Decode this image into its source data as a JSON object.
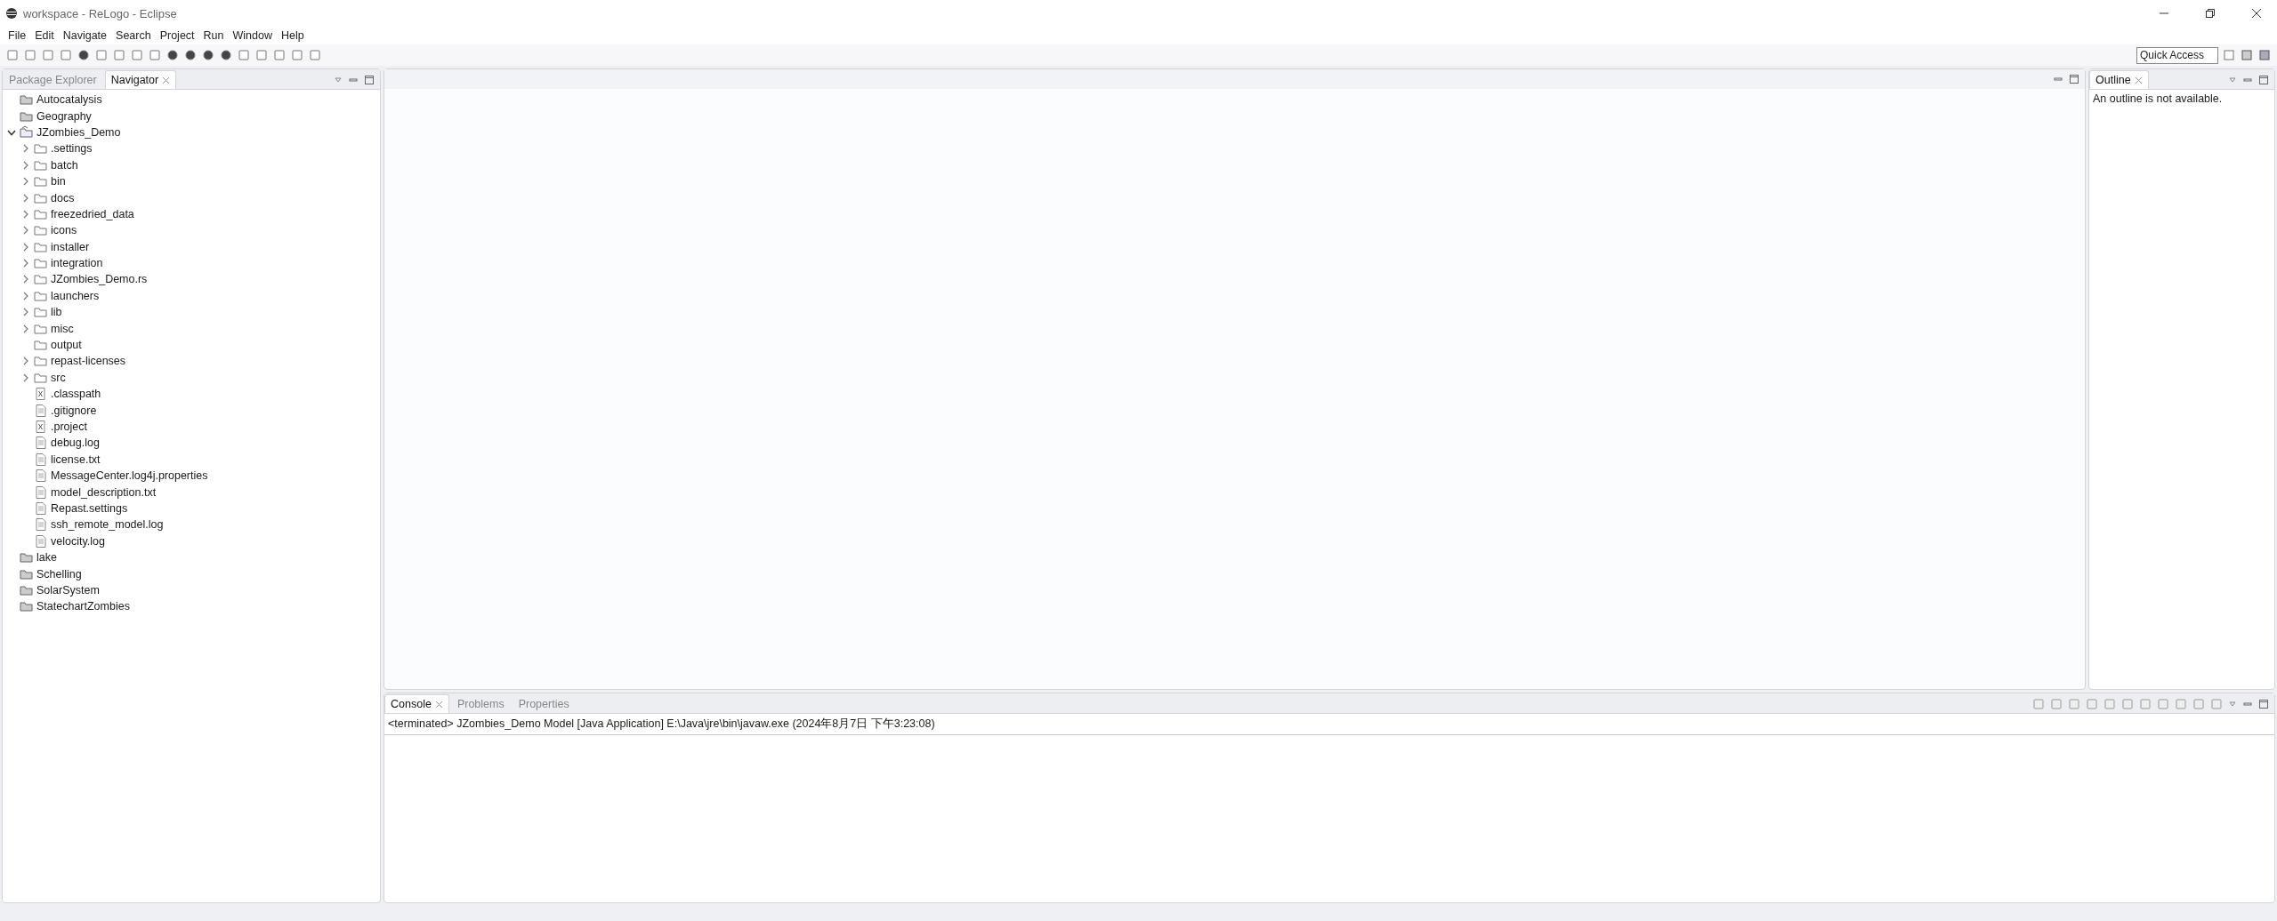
{
  "window": {
    "title": "workspace - ReLogo - Eclipse"
  },
  "menu": [
    "File",
    "Edit",
    "Navigate",
    "Search",
    "Project",
    "Run",
    "Window",
    "Help"
  ],
  "quick_access": {
    "placeholder": "Quick Access"
  },
  "left_panel": {
    "tabs": [
      {
        "label": "Package Explorer",
        "selected": false
      },
      {
        "label": "Navigator",
        "selected": true
      }
    ],
    "tree": [
      {
        "label": "Autocatalysis",
        "kind": "closed-project"
      },
      {
        "label": "Geography",
        "kind": "closed-project"
      },
      {
        "label": "JZombies_Demo",
        "kind": "project",
        "expanded": true,
        "children": [
          {
            "label": ".settings",
            "kind": "folder",
            "expanded": false
          },
          {
            "label": "batch",
            "kind": "folder",
            "expanded": false
          },
          {
            "label": "bin",
            "kind": "folder",
            "expanded": false
          },
          {
            "label": "docs",
            "kind": "folder",
            "expanded": false
          },
          {
            "label": "freezedried_data",
            "kind": "folder",
            "expanded": false
          },
          {
            "label": "icons",
            "kind": "folder",
            "expanded": false
          },
          {
            "label": "installer",
            "kind": "folder",
            "expanded": false
          },
          {
            "label": "integration",
            "kind": "folder",
            "expanded": false
          },
          {
            "label": "JZombies_Demo.rs",
            "kind": "folder",
            "expanded": false
          },
          {
            "label": "launchers",
            "kind": "folder",
            "expanded": false
          },
          {
            "label": "lib",
            "kind": "folder",
            "expanded": false
          },
          {
            "label": "misc",
            "kind": "folder",
            "expanded": false
          },
          {
            "label": "output",
            "kind": "folder"
          },
          {
            "label": "repast-licenses",
            "kind": "folder",
            "expanded": false
          },
          {
            "label": "src",
            "kind": "folder",
            "expanded": false
          },
          {
            "label": ".classpath",
            "kind": "xml-file"
          },
          {
            "label": ".gitignore",
            "kind": "file"
          },
          {
            "label": ".project",
            "kind": "xml-file"
          },
          {
            "label": "debug.log",
            "kind": "file"
          },
          {
            "label": "license.txt",
            "kind": "file"
          },
          {
            "label": "MessageCenter.log4j.properties",
            "kind": "file"
          },
          {
            "label": "model_description.txt",
            "kind": "file"
          },
          {
            "label": "Repast.settings",
            "kind": "file"
          },
          {
            "label": "ssh_remote_model.log",
            "kind": "file"
          },
          {
            "label": "velocity.log",
            "kind": "file"
          }
        ]
      },
      {
        "label": "lake",
        "kind": "closed-project"
      },
      {
        "label": "Schelling",
        "kind": "closed-project"
      },
      {
        "label": "SolarSystem",
        "kind": "closed-project"
      },
      {
        "label": "StatechartZombies",
        "kind": "closed-project"
      }
    ]
  },
  "outline": {
    "tab": "Outline",
    "message": "An outline is not available."
  },
  "console": {
    "tabs": [
      {
        "label": "Console",
        "selected": true
      },
      {
        "label": "Problems",
        "selected": false
      },
      {
        "label": "Properties",
        "selected": false
      }
    ],
    "line": "<terminated> JZombies_Demo Model [Java Application] E:\\Java\\jre\\bin\\javaw.exe (2024年8月7日 下午3:23:08)"
  }
}
